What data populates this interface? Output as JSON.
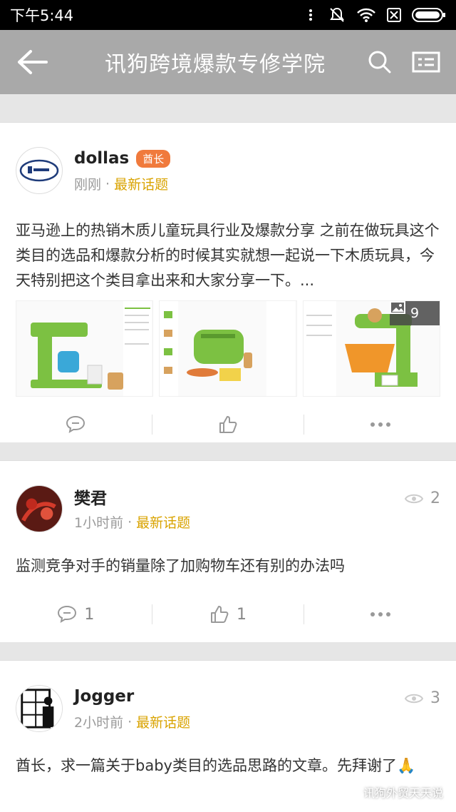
{
  "status": {
    "time": "下午5:44"
  },
  "appbar": {
    "title": "讯狗跨境爆款专修学院"
  },
  "posts": [
    {
      "user": "dollas",
      "badge": "酋长",
      "time": "刚刚",
      "topic": "最新话题",
      "content": "亚马逊上的热销木质儿童玩具行业及爆款分享 之前在做玩具这个类目的选品和爆款分析的时候其实就想一起说一下木质玩具，今天特别把这个类目拿出来和大家分享一下。...",
      "image_count": "9",
      "comments": "",
      "likes": ""
    },
    {
      "user": "樊君",
      "time": "1小时前",
      "topic": "最新话题",
      "views": "2",
      "content": "监测竞争对手的销量除了加购物车还有别的办法吗",
      "comments": "1",
      "likes": "1"
    },
    {
      "user": "Jogger",
      "time": "2小时前",
      "topic": "最新话题",
      "views": "3",
      "content": "酋长，求一篇关于baby类目的选品思路的文章。先拜谢了🙏"
    }
  ],
  "watermark": "讯狗外贸天天说",
  "colors": {
    "accent": "#d9a300",
    "badge": "#f07a3c",
    "appbar": "#a9a9a9"
  }
}
